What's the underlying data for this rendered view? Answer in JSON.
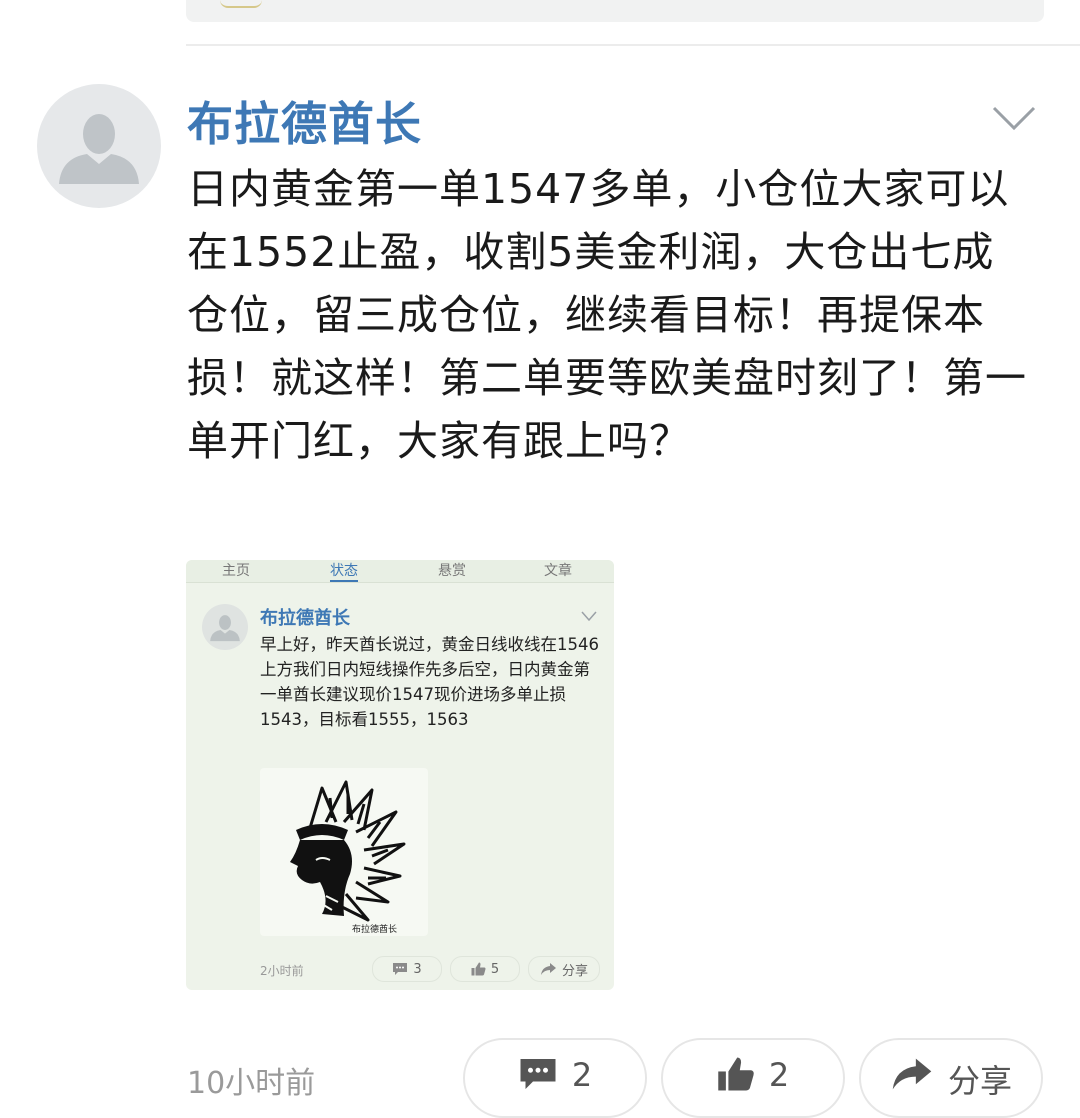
{
  "post": {
    "username": "布拉德酋长",
    "text": "日内黄金第一单1547多单，小仓位大家可以在1552止盈，收割5美金利润，大仓出七成仓位，留三成仓位，继续看目标！再提保本损！就这样！第二单要等欧美盘时刻了！第一单开门红，大家有跟上吗？",
    "time": "10小时前",
    "actions": {
      "comments": "2",
      "likes": "2",
      "share_label": "分享"
    }
  },
  "embedded": {
    "tabs": [
      "主页",
      "状态",
      "悬赏",
      "文章"
    ],
    "active_tab": 1,
    "username": "布拉德酋长",
    "text": "早上好，昨天酋长说过，黄金日线收线在1546上方我们日内短线操作先多后空，日内黄金第一单酋长建议现价1547现价进场多单止损1543，目标看1555，1563",
    "logo_caption": "布拉德酋长",
    "time": "2小时前",
    "actions": {
      "comments": "3",
      "likes": "5",
      "share_label": "分享"
    }
  },
  "colors": {
    "username": "#3e78b5",
    "card_bg": "#eef3ea",
    "muted": "#9a9a9a"
  },
  "icons": [
    "user-avatar-icon",
    "chevron-down-icon",
    "comment-icon",
    "thumbs-up-icon",
    "share-arrow-icon",
    "chief-headdress-logo"
  ]
}
